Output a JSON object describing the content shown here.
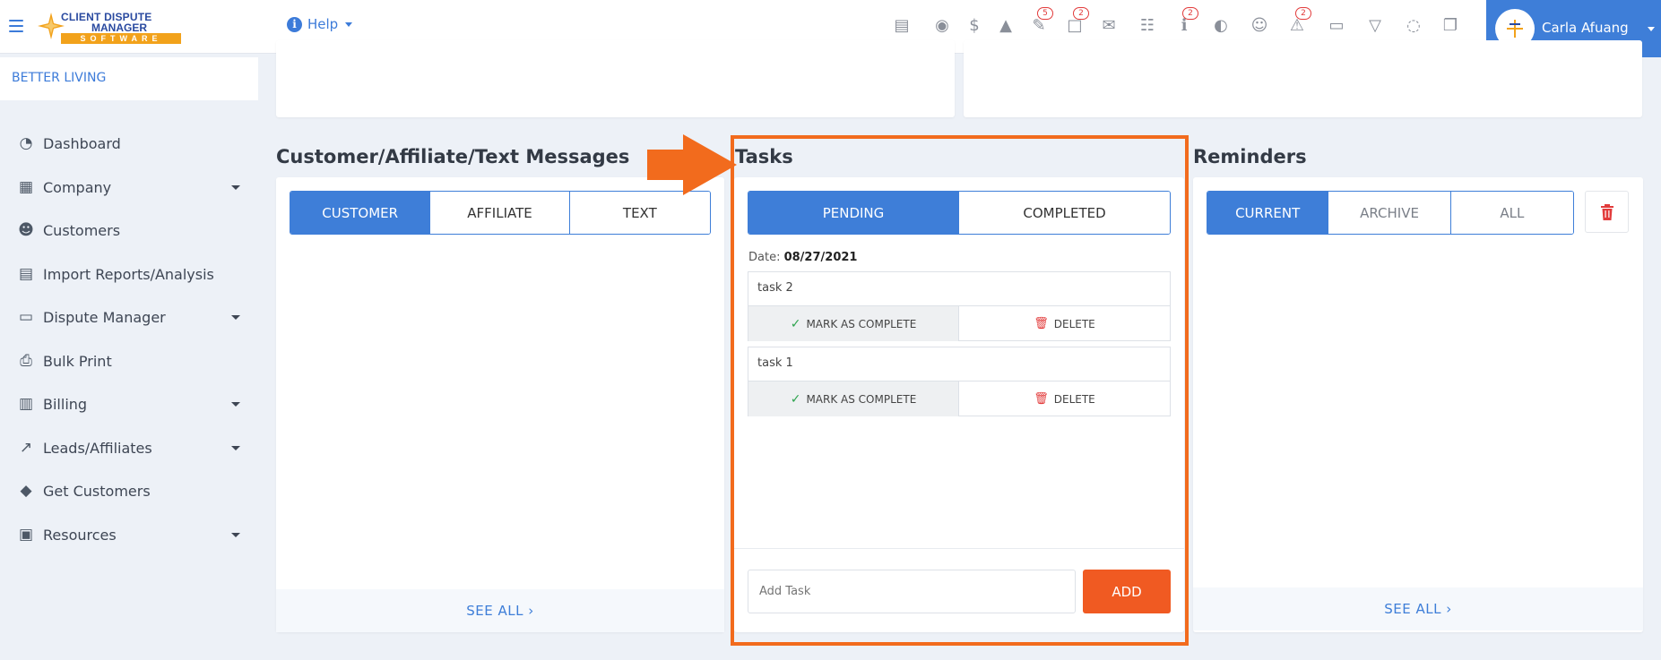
{
  "brand": {
    "logo_line1": "CLIENT DISPUTE",
    "logo_line2": "MANAGER",
    "logo_line3": "SOFTWARE"
  },
  "header": {
    "help_label": "Help",
    "icons": [
      {
        "name": "id-card-icon",
        "glyph": "▤",
        "badge": ""
      },
      {
        "name": "user-headset-icon",
        "glyph": "◉",
        "badge": ""
      },
      {
        "name": "dollar-icon",
        "glyph": "$",
        "badge": ""
      },
      {
        "name": "user-tie-icon",
        "glyph": "▲",
        "badge": ""
      },
      {
        "name": "pen-icon",
        "glyph": "✎",
        "badge": "5"
      },
      {
        "name": "document-icon",
        "glyph": "□",
        "badge": "2"
      },
      {
        "name": "envelope-icon",
        "glyph": "✉",
        "badge": ""
      },
      {
        "name": "sitemap-icon",
        "glyph": "☷",
        "badge": ""
      },
      {
        "name": "info-icon",
        "glyph": "ℹ",
        "badge": "2"
      },
      {
        "name": "globe-icon",
        "glyph": "◐",
        "badge": ""
      },
      {
        "name": "users-icon",
        "glyph": "☺",
        "badge": ""
      },
      {
        "name": "warning-icon",
        "glyph": "⚠",
        "badge": "2"
      },
      {
        "name": "money-icon",
        "glyph": "▭",
        "badge": ""
      },
      {
        "name": "inbox-icon",
        "glyph": "▽",
        "badge": ""
      },
      {
        "name": "comments-icon",
        "glyph": "◌",
        "badge": ""
      },
      {
        "name": "copy-icon",
        "glyph": "❐",
        "badge": ""
      }
    ],
    "user_name": "Carla Afuang"
  },
  "sidebar": {
    "company": "BETTER LIVING",
    "items": [
      {
        "label": "Dashboard",
        "icon": "◔",
        "caret": false
      },
      {
        "label": "Company",
        "icon": "▦",
        "caret": true
      },
      {
        "label": "Customers",
        "icon": "☻",
        "caret": false
      },
      {
        "label": "Import Reports/Analysis",
        "icon": "▤",
        "caret": false
      },
      {
        "label": "Dispute Manager",
        "icon": "▭",
        "caret": true
      },
      {
        "label": "Bulk Print",
        "icon": "⎙",
        "caret": false
      },
      {
        "label": "Billing",
        "icon": "▥",
        "caret": true
      },
      {
        "label": "Leads/Affiliates",
        "icon": "↗",
        "caret": true
      },
      {
        "label": "Get Customers",
        "icon": "◆",
        "caret": false
      },
      {
        "label": "Resources",
        "icon": "▣",
        "caret": true
      }
    ]
  },
  "messages": {
    "title": "Customer/Affiliate/Text Messages",
    "tabs": [
      "CUSTOMER",
      "AFFILIATE",
      "TEXT"
    ],
    "see_all": "SEE ALL ›"
  },
  "tasks": {
    "title": "Tasks",
    "tabs": [
      "PENDING",
      "COMPLETED"
    ],
    "date_label": "Date:",
    "date_value": "08/27/2021",
    "items": [
      {
        "name": "task 2",
        "complete_label": "MARK AS COMPLETE",
        "delete_label": "DELETE"
      },
      {
        "name": "task 1",
        "complete_label": "MARK AS COMPLETE",
        "delete_label": "DELETE"
      }
    ],
    "add_placeholder": "Add Task",
    "add_label": "ADD"
  },
  "reminders": {
    "title": "Reminders",
    "tabs": [
      "CURRENT",
      "ARCHIVE",
      "ALL"
    ],
    "see_all": "SEE ALL ›"
  },
  "colors": {
    "primary": "#3e7ed8",
    "accent": "#f05a22",
    "highlight": "#f26b1d",
    "danger": "#e23b3b"
  }
}
